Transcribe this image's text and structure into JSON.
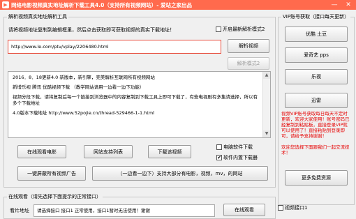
{
  "window": {
    "title": "网络电影视频真实地址解析下载工具4.0（支持所有视频网站）- 爱站之家出品",
    "minimize": "—",
    "close": "✕"
  },
  "parser": {
    "group_title": "解析视频真实地址解析工具",
    "instruction": "请将视频地址复制到编辑框里，然后点击获取即可获取视频的真实下载地址！",
    "enable_mode_label": "开启最新解析模式2",
    "enable_mode_checked": false,
    "url_value": "http://www.le.com/ptv/vplay/2206480.html",
    "parse_button": "解析视频",
    "parse_mode2_button": "解析模式2"
  },
  "info": {
    "lines": [
      "2016．8．18更新4.0 新版本，新引擎，完美解析互联网所有视频网站",
      "新增乐视 腾讯 优酷视频下载 （教学网站请用一边看一边下功能）",
      "视频分段下载，请将复制后每一个链接到浏览器中的内容复制到下载工具上即可下载了，有些电视剧有多集请选择，所以有多个下载地址",
      "4.0版本下载地址 http://www.52pojie.cn/thread-529466-1-1.html"
    ]
  },
  "actions": {
    "watch_online": "在线观看电影",
    "supported_sites": "网站支持列表",
    "download_video": "下载该视频",
    "computer_software_download": "电脑软件下载",
    "computer_software_download_checked": false,
    "use_builtin_downloader": "软件内置下载器",
    "use_builtin_downloader_checked": true,
    "block_ads": "一键屏蔽所有视频广告",
    "watch_while_download": "（一边看一边下）支持大部分有电影，视频，mv，的网站"
  },
  "online": {
    "group_title": "在线观看（请先选择下面提示的正常接口）",
    "hint_label": "看片地址",
    "hint_value": "请选择接口 接口1 正常使用，接口1暂时无法使用！谢谢",
    "watch_button": "在线观看",
    "interface_label": "视频接口1",
    "interface_checked": false
  },
  "vip": {
    "group_title": "VIP账号获取（接口每天更新）",
    "youku": "优酷 土豆",
    "iqiyi": "爱奇艺 pps",
    "letv": "乐视",
    "xunlei": "迅雷",
    "notice": "视频VIP账号获取每日每天不定时更新，欢迎大家使用！账号密码已经复制到粘贴板，直接登录VIP就可以使用了！直接粘贴到登录即可，请给予支持谢谢！",
    "thanks": "欢迎您选择下面跟我们一起交流技术！",
    "more_resources": "更多免费资源"
  }
}
